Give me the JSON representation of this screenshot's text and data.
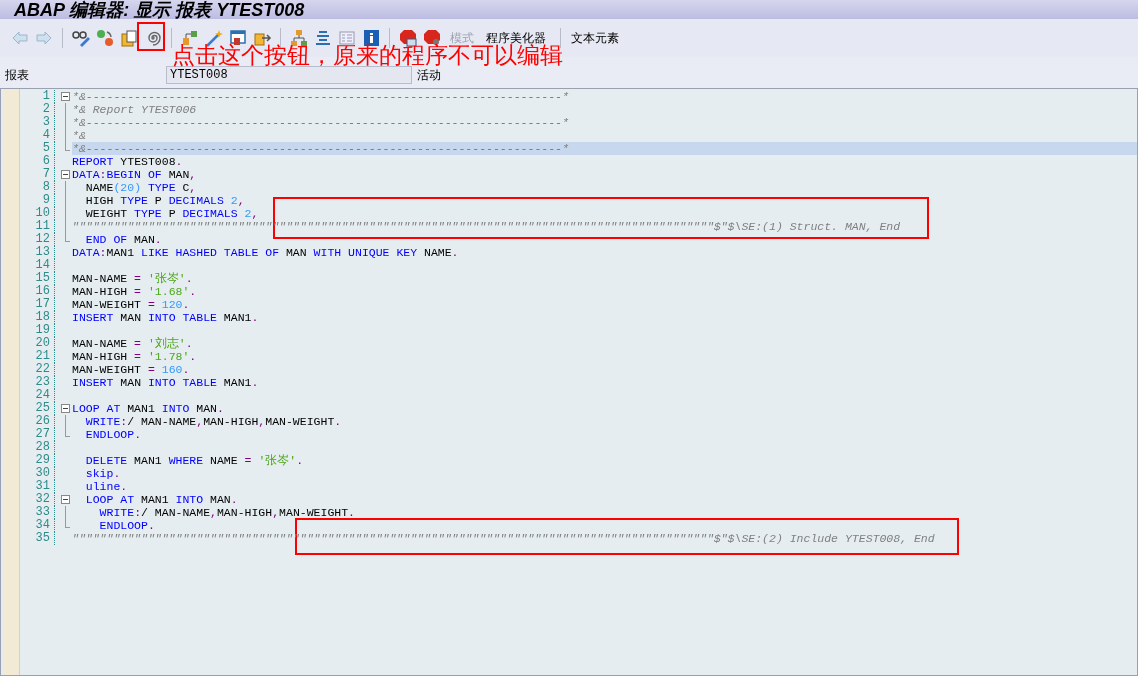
{
  "window": {
    "title": "ABAP 编辑器: 显示 报表 YTEST008"
  },
  "toolbar": {
    "buttons": [
      {
        "label": "模式",
        "disabled": true
      },
      {
        "label": "程序美化器",
        "disabled": false
      },
      {
        "label": "文本元素",
        "disabled": false
      }
    ]
  },
  "annotation": {
    "text": "点击这个按钮，原来的程序不可以编辑"
  },
  "header": {
    "label": "报表",
    "program": "YTEST008",
    "status": "活动"
  },
  "editor": {
    "lines": [
      {
        "number": "1",
        "kind": "fold_start",
        "selected": false,
        "tokens": [
          {
            "kind": "cmt",
            "text": "*&---------------------------------------------------------------------*"
          }
        ]
      },
      {
        "number": "2",
        "kind": "fold_inner",
        "selected": false,
        "tokens": [
          {
            "kind": "cmt",
            "text": "*& Report YTEST006"
          }
        ]
      },
      {
        "number": "3",
        "kind": "fold_inner",
        "selected": false,
        "tokens": [
          {
            "kind": "cmt",
            "text": "*&---------------------------------------------------------------------*"
          }
        ]
      },
      {
        "number": "4",
        "kind": "fold_inner",
        "selected": false,
        "tokens": [
          {
            "kind": "cmt",
            "text": "*&"
          }
        ]
      },
      {
        "number": "5",
        "kind": "fold_end",
        "selected": true,
        "tokens": [
          {
            "kind": "cmt",
            "text": "*&---------------------------------------------------------------------*"
          }
        ]
      },
      {
        "number": "6",
        "kind": "plain",
        "selected": false,
        "tokens": [
          {
            "kind": "kw",
            "text": "REPORT"
          },
          {
            "kind": "tx",
            "text": " YTEST008"
          },
          {
            "kind": "pu",
            "text": "."
          }
        ]
      },
      {
        "number": "7",
        "kind": "fold_start",
        "selected": false,
        "tokens": [
          {
            "kind": "kw",
            "text": "DATA"
          },
          {
            "kind": "pu",
            "text": ":"
          },
          {
            "kind": "kw",
            "text": "BEGIN OF"
          },
          {
            "kind": "tx",
            "text": " MAN"
          },
          {
            "kind": "pu",
            "text": ","
          }
        ]
      },
      {
        "number": "8",
        "kind": "fold_inner",
        "selected": false,
        "tokens": [
          {
            "kind": "tx",
            "text": "  NAME"
          },
          {
            "kind": "num",
            "text": "(20)"
          },
          {
            "kind": "kw",
            "text": " TYPE"
          },
          {
            "kind": "tx",
            "text": " C"
          },
          {
            "kind": "pu",
            "text": ","
          }
        ]
      },
      {
        "number": "9",
        "kind": "fold_inner",
        "selected": false,
        "tokens": [
          {
            "kind": "tx",
            "text": "  HIGH"
          },
          {
            "kind": "kw",
            "text": " TYPE"
          },
          {
            "kind": "tx",
            "text": " P"
          },
          {
            "kind": "kw",
            "text": " DECIMALS"
          },
          {
            "kind": "num",
            "text": " 2"
          },
          {
            "kind": "pu",
            "text": ","
          }
        ]
      },
      {
        "number": "10",
        "kind": "fold_inner",
        "selected": false,
        "tokens": [
          {
            "kind": "tx",
            "text": "  WEIGHT"
          },
          {
            "kind": "kw",
            "text": " TYPE"
          },
          {
            "kind": "tx",
            "text": " P"
          },
          {
            "kind": "kw",
            "text": " DECIMALS"
          },
          {
            "kind": "num",
            "text": " 2"
          },
          {
            "kind": "pu",
            "text": ","
          }
        ]
      },
      {
        "number": "11",
        "kind": "fold_inner",
        "selected": false,
        "tokens": [
          {
            "kind": "cmt",
            "text": "\"\"\"\"\"\"\"\"\"\"\"\"\"\"\"\"\"\"\"\"\"\"\"\"\"\"\"\"\"\"\"\"\"\"\"\"\"\"\"\"\"\"\"\"\"\"\"\"\"\"\"\"\"\"\"\"\"\"\"\"\"\"\"\"\"\"\"\"\"\"\"\"\"\"\"\"\"\"\"\"\"\"\"\"\"\"\"\"\"\"\"\"\"$\"$\\SE:(1) Struct. MAN, End"
          }
        ]
      },
      {
        "number": "12",
        "kind": "fold_end",
        "selected": false,
        "tokens": [
          {
            "kind": "kw",
            "text": "  END OF"
          },
          {
            "kind": "tx",
            "text": " MAN"
          },
          {
            "kind": "pu",
            "text": "."
          }
        ]
      },
      {
        "number": "13",
        "kind": "plain",
        "selected": false,
        "tokens": [
          {
            "kind": "kw",
            "text": "DATA"
          },
          {
            "kind": "pu",
            "text": ":"
          },
          {
            "kind": "tx",
            "text": "MAN1"
          },
          {
            "kind": "kw",
            "text": " LIKE HASHED TABLE OF"
          },
          {
            "kind": "tx",
            "text": " MAN"
          },
          {
            "kind": "kw",
            "text": " WITH UNIQUE KEY"
          },
          {
            "kind": "tx",
            "text": " NAME"
          },
          {
            "kind": "pu",
            "text": "."
          }
        ]
      },
      {
        "number": "14",
        "kind": "plain",
        "selected": false
      },
      {
        "number": "15",
        "kind": "plain",
        "selected": false,
        "tokens": [
          {
            "kind": "tx",
            "text": "MAN-NAME"
          },
          {
            "kind": "pu",
            "text": " ="
          },
          {
            "kind": "str",
            "text": " '张岑'"
          },
          {
            "kind": "pu",
            "text": "."
          }
        ]
      },
      {
        "number": "16",
        "kind": "plain",
        "selected": false,
        "tokens": [
          {
            "kind": "tx",
            "text": "MAN-HIGH"
          },
          {
            "kind": "pu",
            "text": " ="
          },
          {
            "kind": "str",
            "text": " '1.68'"
          },
          {
            "kind": "pu",
            "text": "."
          }
        ]
      },
      {
        "number": "17",
        "kind": "plain",
        "selected": false,
        "tokens": [
          {
            "kind": "tx",
            "text": "MAN-WEIGHT"
          },
          {
            "kind": "pu",
            "text": " ="
          },
          {
            "kind": "num",
            "text": " 120"
          },
          {
            "kind": "pu",
            "text": "."
          }
        ]
      },
      {
        "number": "18",
        "kind": "plain",
        "selected": false,
        "tokens": [
          {
            "kind": "kw",
            "text": "INSERT"
          },
          {
            "kind": "tx",
            "text": " MAN"
          },
          {
            "kind": "kw",
            "text": " INTO TABLE"
          },
          {
            "kind": "tx",
            "text": " MAN1"
          },
          {
            "kind": "pu",
            "text": "."
          }
        ]
      },
      {
        "number": "19",
        "kind": "plain",
        "selected": false
      },
      {
        "number": "20",
        "kind": "plain",
        "selected": false,
        "tokens": [
          {
            "kind": "tx",
            "text": "MAN-NAME"
          },
          {
            "kind": "pu",
            "text": " ="
          },
          {
            "kind": "str",
            "text": " '刘志'"
          },
          {
            "kind": "pu",
            "text": "."
          }
        ]
      },
      {
        "number": "21",
        "kind": "plain",
        "selected": false,
        "tokens": [
          {
            "kind": "tx",
            "text": "MAN-HIGH"
          },
          {
            "kind": "pu",
            "text": " ="
          },
          {
            "kind": "str",
            "text": " '1.78'"
          },
          {
            "kind": "pu",
            "text": "."
          }
        ]
      },
      {
        "number": "22",
        "kind": "plain",
        "selected": false,
        "tokens": [
          {
            "kind": "tx",
            "text": "MAN-WEIGHT"
          },
          {
            "kind": "pu",
            "text": " ="
          },
          {
            "kind": "num",
            "text": " 160"
          },
          {
            "kind": "pu",
            "text": "."
          }
        ]
      },
      {
        "number": "23",
        "kind": "plain",
        "selected": false,
        "tokens": [
          {
            "kind": "kw",
            "text": "INSERT"
          },
          {
            "kind": "tx",
            "text": " MAN"
          },
          {
            "kind": "kw",
            "text": " INTO TABLE"
          },
          {
            "kind": "tx",
            "text": " MAN1"
          },
          {
            "kind": "pu",
            "text": "."
          }
        ]
      },
      {
        "number": "24",
        "kind": "plain",
        "selected": false
      },
      {
        "number": "25",
        "kind": "fold_start",
        "selected": false,
        "tokens": [
          {
            "kind": "kw",
            "text": "LOOP AT"
          },
          {
            "kind": "tx",
            "text": " MAN1"
          },
          {
            "kind": "kw",
            "text": " INTO"
          },
          {
            "kind": "tx",
            "text": " MAN"
          },
          {
            "kind": "pu",
            "text": "."
          }
        ]
      },
      {
        "number": "26",
        "kind": "fold_inner",
        "selected": false,
        "tokens": [
          {
            "kind": "kw",
            "text": "  WRITE"
          },
          {
            "kind": "pu",
            "text": ":"
          },
          {
            "kind": "tx",
            "text": "/ MAN-NAME"
          },
          {
            "kind": "pu",
            "text": ","
          },
          {
            "kind": "tx",
            "text": "MAN-HIGH"
          },
          {
            "kind": "pu",
            "text": ","
          },
          {
            "kind": "tx",
            "text": "MAN-WEIGHT"
          },
          {
            "kind": "pu",
            "text": "."
          }
        ]
      },
      {
        "number": "27",
        "kind": "fold_end",
        "selected": false,
        "tokens": [
          {
            "kind": "kw",
            "text": "  ENDLOOP"
          },
          {
            "kind": "pu",
            "text": "."
          }
        ]
      },
      {
        "number": "28",
        "kind": "plain",
        "selected": false
      },
      {
        "number": "29",
        "kind": "plain",
        "selected": false,
        "tokens": [
          {
            "kind": "kw",
            "text": "  DELETE"
          },
          {
            "kind": "tx",
            "text": " MAN1"
          },
          {
            "kind": "kw",
            "text": " WHERE"
          },
          {
            "kind": "tx",
            "text": " NAME"
          },
          {
            "kind": "pu",
            "text": " ="
          },
          {
            "kind": "str",
            "text": " '张岑'"
          },
          {
            "kind": "pu",
            "text": "."
          }
        ]
      },
      {
        "number": "30",
        "kind": "plain",
        "selected": false,
        "tokens": [
          {
            "kind": "kw",
            "text": "  skip"
          },
          {
            "kind": "pu",
            "text": "."
          }
        ]
      },
      {
        "number": "31",
        "kind": "plain",
        "selected": false,
        "tokens": [
          {
            "kind": "kw",
            "text": "  uline"
          },
          {
            "kind": "pu",
            "text": "."
          }
        ]
      },
      {
        "number": "32",
        "kind": "fold_start",
        "selected": false,
        "tokens": [
          {
            "kind": "kw",
            "text": "  LOOP AT"
          },
          {
            "kind": "tx",
            "text": " MAN1"
          },
          {
            "kind": "kw",
            "text": " INTO"
          },
          {
            "kind": "tx",
            "text": " MAN"
          },
          {
            "kind": "pu",
            "text": "."
          }
        ]
      },
      {
        "number": "33",
        "kind": "fold_inner",
        "selected": false,
        "tokens": [
          {
            "kind": "kw",
            "text": "    WRITE"
          },
          {
            "kind": "pu",
            "text": ":"
          },
          {
            "kind": "tx",
            "text": "/ MAN-NAME"
          },
          {
            "kind": "pu",
            "text": ","
          },
          {
            "kind": "tx",
            "text": "MAN-HIGH"
          },
          {
            "kind": "pu",
            "text": ","
          },
          {
            "kind": "tx",
            "text": "MAN-WEIGHT"
          },
          {
            "kind": "pu",
            "text": "."
          }
        ]
      },
      {
        "number": "34",
        "kind": "fold_end",
        "selected": false,
        "tokens": [
          {
            "kind": "kw",
            "text": "    ENDLOOP"
          },
          {
            "kind": "pu",
            "text": "."
          }
        ]
      },
      {
        "number": "35",
        "kind": "plain",
        "selected": false,
        "tokens": [
          {
            "kind": "cmt",
            "text": "\"\"\"\"\"\"\"\"\"\"\"\"\"\"\"\"\"\"\"\"\"\"\"\"\"\"\"\"\"\"\"\"\"\"\"\"\"\"\"\"\"\"\"\"\"\"\"\"\"\"\"\"\"\"\"\"\"\"\"\"\"\"\"\"\"\"\"\"\"\"\"\"\"\"\"\"\"\"\"\"\"\"\"\"\"\"\"\"\"\"\"\"\"$\"$\\SE:(2) Include YTEST008, End"
          }
        ]
      }
    ]
  }
}
